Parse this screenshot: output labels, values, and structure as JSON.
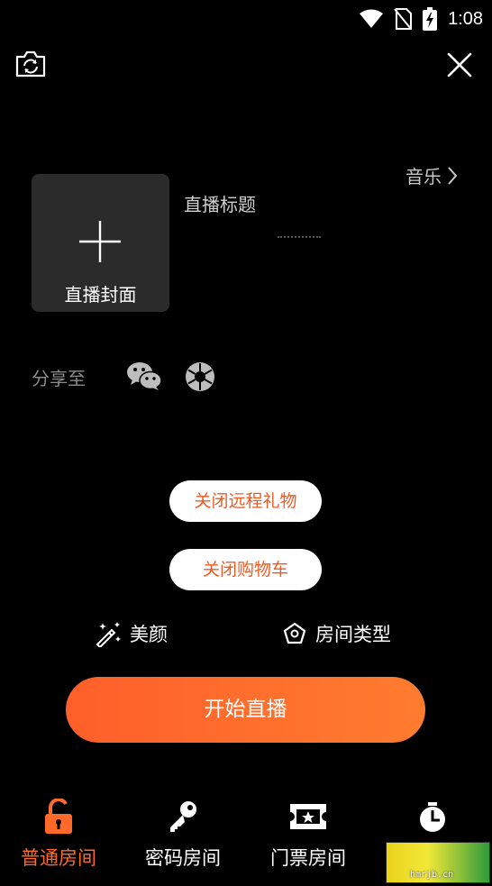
{
  "status_bar": {
    "time": "1:08",
    "icons": [
      "wifi-icon",
      "no-sim-icon",
      "battery-charging-icon"
    ]
  },
  "header": {
    "camera_icon": "camera-switch-icon",
    "close_icon": "close-icon"
  },
  "cover": {
    "label": "直播封面",
    "icon": "plus-icon"
  },
  "title_field": {
    "placeholder": "直播标题"
  },
  "music": {
    "label": "音乐",
    "icon": "chevron-right-icon"
  },
  "share": {
    "label": "分享至",
    "targets": [
      "wechat-icon",
      "moments-icon"
    ]
  },
  "toggles": {
    "remote_gift": "关闭远程礼物",
    "shopping_cart": "关闭购物车"
  },
  "options": {
    "beauty": "美颜",
    "room_type": "房间类型"
  },
  "start_button": "开始直播",
  "tabs": [
    {
      "label": "普通房间",
      "icon": "unlock-icon",
      "active": true
    },
    {
      "label": "密码房间",
      "icon": "key-icon",
      "active": false
    },
    {
      "label": "门票房间",
      "icon": "ticket-icon",
      "active": false
    },
    {
      "label": "",
      "icon": "timer-icon",
      "active": false
    }
  ],
  "watermark": {
    "text": "hmrjb.cn"
  },
  "colors": {
    "accent": "#ff6a2a",
    "background": "#000000",
    "cover_bg": "#2b2b2b"
  }
}
